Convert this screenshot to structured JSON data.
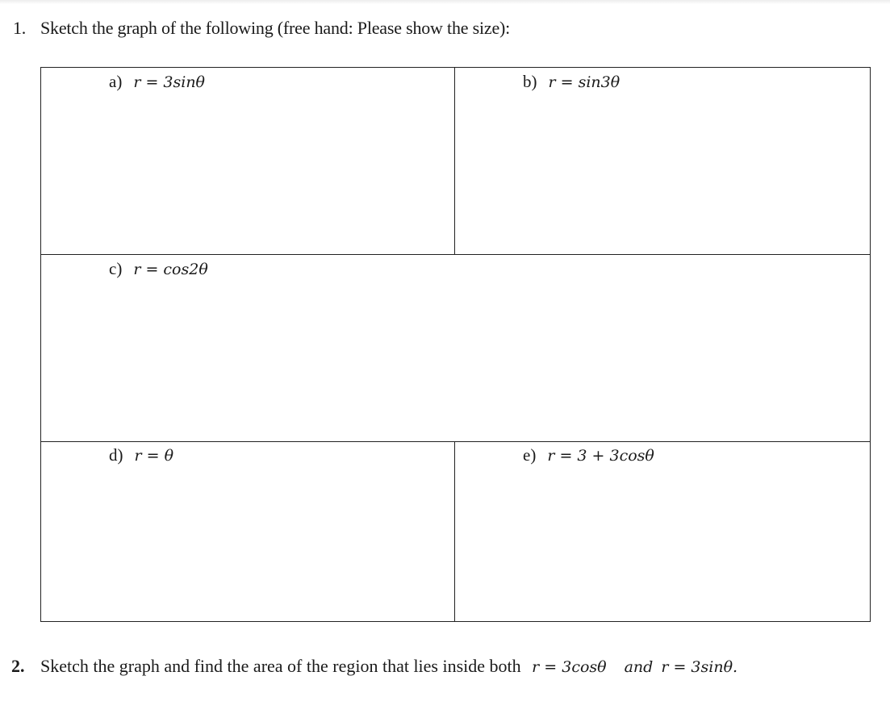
{
  "question1": {
    "number": "1.",
    "prompt": "Sketch the graph of the following (free hand: Please show the size):",
    "parts": [
      {
        "letter": "a)",
        "equation": "r = 3sinθ"
      },
      {
        "letter": "b)",
        "equation": "r = sin3θ"
      },
      {
        "letter": "c)",
        "equation": "r = cos2θ"
      },
      {
        "letter": "d)",
        "equation": "r = θ"
      },
      {
        "letter": "e)",
        "equation": "r = 3 + 3cosθ"
      }
    ]
  },
  "question2": {
    "number": "2.",
    "prompt": "Sketch the graph and find the area of the region that lies inside both",
    "equation1": "r = 3cosθ",
    "conjunction": "and",
    "equation2": "r = 3sinθ."
  }
}
